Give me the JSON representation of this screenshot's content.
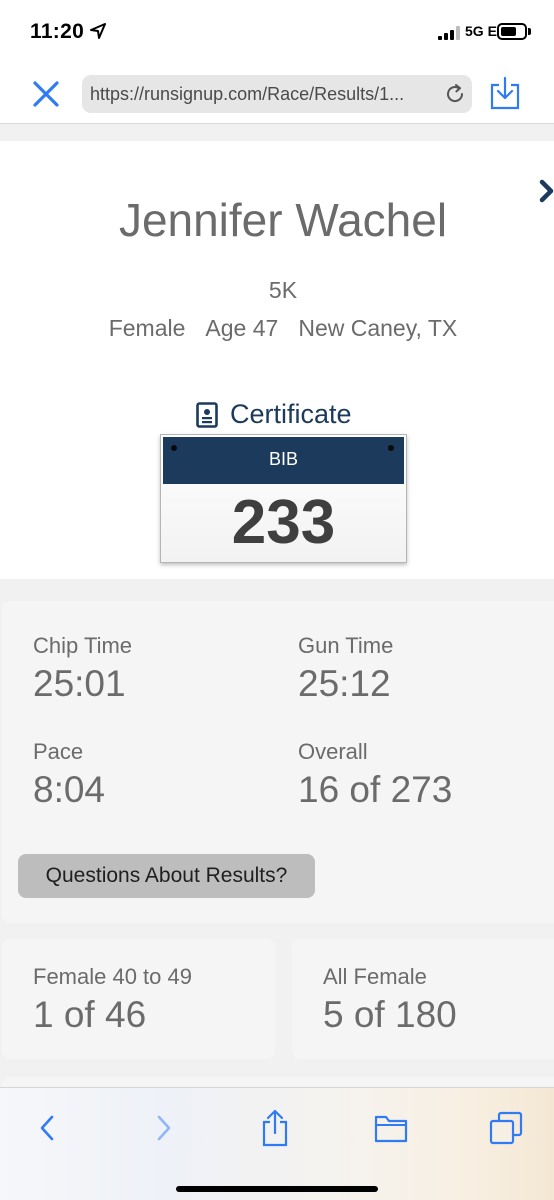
{
  "status_bar": {
    "time": "11:20",
    "network": "5G E"
  },
  "browser": {
    "url": "https://runsignup.com/Race/Results/1..."
  },
  "runner": {
    "name": "Jennifer Wachel",
    "race": "5K",
    "gender": "Female",
    "age": "Age 47",
    "location": "New Caney, TX"
  },
  "certificate": {
    "label": "Certificate"
  },
  "bib": {
    "label": "BIB",
    "number": "233"
  },
  "results": {
    "chip_time_label": "Chip Time",
    "chip_time": "25:01",
    "gun_time_label": "Gun Time",
    "gun_time": "25:12",
    "pace_label": "Pace",
    "pace": "8:04",
    "overall_label": "Overall",
    "overall": "16 of 273",
    "questions_button": "Questions About Results?"
  },
  "placements": [
    {
      "label": "Female 40 to 49",
      "value": "1 of 46"
    },
    {
      "label": "All Female",
      "value": "5 of 180"
    }
  ],
  "colors": {
    "accent": "#1b3a5c",
    "ios_blue": "#2f7bf5",
    "text_gray": "#6b6b6b",
    "card_bg": "#f5f5f5"
  },
  "icons": {
    "close": "close-icon",
    "reload": "reload-icon",
    "download": "download-icon",
    "certificate": "certificate-icon",
    "next_result": "chevron-right-icon",
    "back": "back-icon",
    "forward": "forward-icon",
    "share": "share-icon",
    "bookmarks": "bookmarks-icon",
    "tabs": "tabs-icon"
  }
}
